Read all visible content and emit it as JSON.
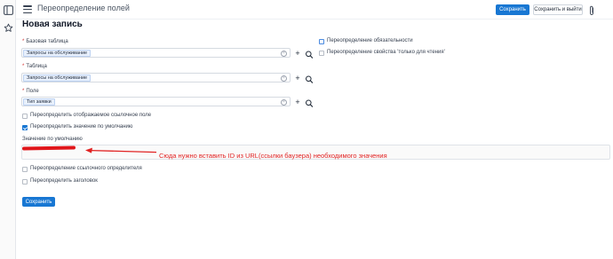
{
  "header": {
    "title": "Переопределение полей",
    "save_label": "Сохранить",
    "save_exit_label": "Сохранить и выйти"
  },
  "page": {
    "title": "Новая запись"
  },
  "fields": {
    "base_table": {
      "label": "Базовая таблица",
      "value": "Запросы на обслуживание"
    },
    "table": {
      "label": "Таблица",
      "value": "Запросы на обслуживание"
    },
    "field": {
      "label": "Поле",
      "value": "Тип заявки"
    }
  },
  "checkboxes": {
    "override_display_ref": {
      "label": "Переопределить отображаемое ссылочное поле",
      "checked": false
    },
    "override_default": {
      "label": "Переопределить значение по умолчанию",
      "checked": true
    },
    "override_ref_qualifier": {
      "label": "Переопределение ссылочного определителя",
      "checked": false
    },
    "override_title": {
      "label": "Переопределить заголовок",
      "checked": false
    },
    "override_mandatory": {
      "label": "Переопределение обязательности",
      "checked": false
    },
    "override_readonly": {
      "label": "Переопределение свойства 'только для чтения'",
      "checked": false
    }
  },
  "default_value": {
    "label": "Значение по умолчанию"
  },
  "annotation": {
    "text": "Сюда нужно вставить ID из URL(ссылки баузера) необходимого значения",
    "color": "#e12222"
  },
  "footer": {
    "save_label": "Сохранить"
  },
  "colors": {
    "primary": "#1877d3",
    "required": "#d12e2e"
  }
}
